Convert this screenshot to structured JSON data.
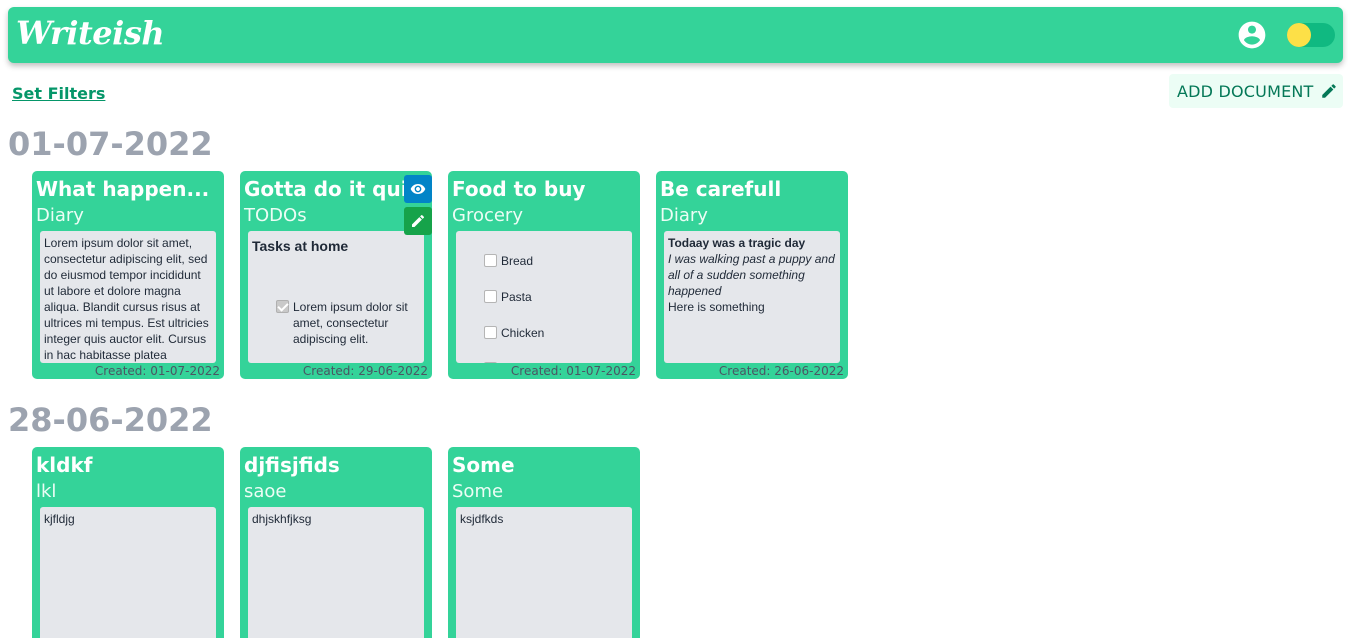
{
  "header": {
    "logo": "Writeish",
    "profile_icon": "account-circle-icon",
    "theme_toggle_icon": "theme-toggle"
  },
  "toolbar": {
    "set_filters": "Set Filters",
    "add_document": "ADD DOCUMENT",
    "add_document_icon": "pencil-icon"
  },
  "colors": {
    "brand": "#34d399",
    "toggle_knob": "#fde047",
    "view_button": "#0284c7",
    "edit_button": "#16a34a"
  },
  "groups": [
    {
      "date": "01-07-2022",
      "cards": [
        {
          "title": "What happen...",
          "category": "Diary",
          "text": "Lorem ipsum dolor sit amet, consectetur adipiscing elit, sed do eiusmod tempor incididunt ut labore et dolore magna aliqua. Blandit cursus risus at ultrices mi tempus. Est ultricies integer quis auctor elit. Cursus in hac habitasse platea",
          "created": "Created: 01-07-2022"
        },
        {
          "title": "Gotta do it quick",
          "category": "TODOs",
          "todo_title": "Tasks at home",
          "todo_item": "Lorem ipsum dolor sit amet, consectetur adipiscing elit.",
          "todo_item_checked": true,
          "created": "Created: 29-06-2022"
        },
        {
          "title": "Food to buy",
          "category": "Grocery",
          "items": [
            "Bread",
            "Pasta",
            "Chicken"
          ],
          "created": "Created: 01-07-2022"
        },
        {
          "title": "Be carefull",
          "category": "Diary",
          "heading": "Todaay was a tragic day",
          "italic": "I was walking past a puppy and all of a sudden something happened",
          "text": "Here is something",
          "created": "Created: 26-06-2022"
        }
      ]
    },
    {
      "date": "28-06-2022",
      "cards": [
        {
          "title": "kldkf",
          "category": "lkl",
          "text": "kjfldjg"
        },
        {
          "title": "djfisjfids",
          "category": "saoe",
          "text": "dhjskhfjksg"
        },
        {
          "title": "Some",
          "category": "Some",
          "text": "ksjdfkds"
        }
      ]
    }
  ]
}
